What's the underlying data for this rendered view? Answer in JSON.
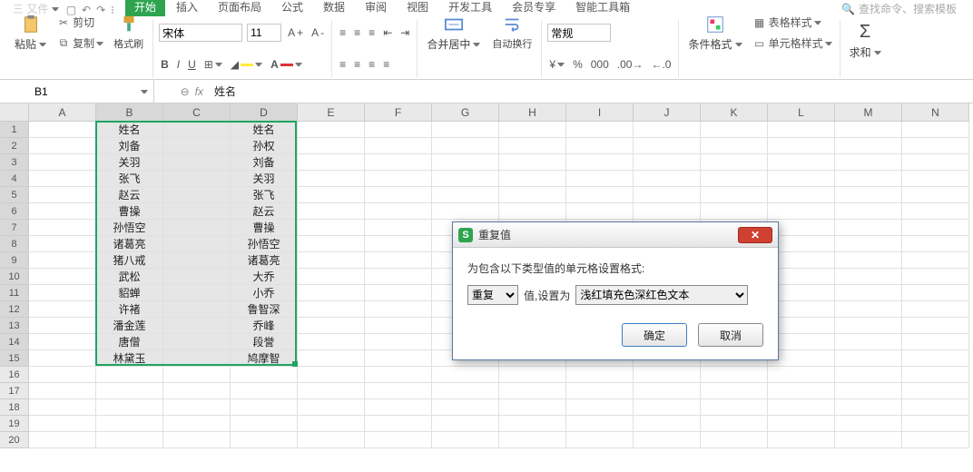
{
  "topbar": {
    "file": "三 又件",
    "search_placeholder": "查找命令、搜索模板"
  },
  "tabs": [
    "开始",
    "插入",
    "页面布局",
    "公式",
    "数据",
    "审阅",
    "视图",
    "开发工具",
    "会员专享",
    "智能工具箱"
  ],
  "active_tab": 0,
  "ribbon": {
    "clipboard": {
      "cut": "剪切",
      "copy": "复制",
      "paste": "粘贴",
      "brush": "格式刷"
    },
    "font": {
      "name": "宋体",
      "size": "11"
    },
    "align": {
      "merge": "合并居中",
      "wrap": "自动换行"
    },
    "number": {
      "label": "常规"
    },
    "styles": {
      "cond": "条件格式",
      "table": "表格样式",
      "cell": "单元格样式"
    },
    "sum": {
      "label": "求和"
    }
  },
  "namebox": "B1",
  "formula": "姓名",
  "cols": [
    "A",
    "B",
    "C",
    "D",
    "E",
    "F",
    "G",
    "H",
    "I",
    "J",
    "K",
    "L",
    "M",
    "N"
  ],
  "sel_cols": [
    "B",
    "C",
    "D"
  ],
  "sel_rows": [
    1,
    2,
    3,
    4,
    5,
    6,
    7,
    8,
    9,
    10,
    11,
    12,
    13,
    14,
    15
  ],
  "rows": 20,
  "data": {
    "1": {
      "B": "姓名",
      "D": "姓名"
    },
    "2": {
      "B": "刘备",
      "D": "孙权"
    },
    "3": {
      "B": "关羽",
      "D": "刘备"
    },
    "4": {
      "B": "张飞",
      "D": "关羽"
    },
    "5": {
      "B": "赵云",
      "D": "张飞"
    },
    "6": {
      "B": "曹操",
      "D": "赵云"
    },
    "7": {
      "B": "孙悟空",
      "D": "曹操"
    },
    "8": {
      "B": "诸葛亮",
      "D": "孙悟空"
    },
    "9": {
      "B": "猪八戒",
      "D": "诸葛亮"
    },
    "10": {
      "B": "武松",
      "D": "大乔"
    },
    "11": {
      "B": "貂蝉",
      "D": "小乔"
    },
    "12": {
      "B": "许褚",
      "D": "鲁智深"
    },
    "13": {
      "B": "潘金莲",
      "D": "乔峰"
    },
    "14": {
      "B": "唐僧",
      "D": "段誉"
    },
    "15": {
      "B": "林黛玉",
      "D": "鸠摩智"
    }
  },
  "dialog": {
    "title": "重复值",
    "desc": "为包含以下类型值的单元格设置格式:",
    "type_options": [
      "重复"
    ],
    "type_selected": "重复",
    "mid": "值,设置为",
    "style_options": [
      "浅红填充色深红色文本"
    ],
    "style_selected": "浅红填充色深红色文本",
    "ok": "确定",
    "cancel": "取消"
  }
}
